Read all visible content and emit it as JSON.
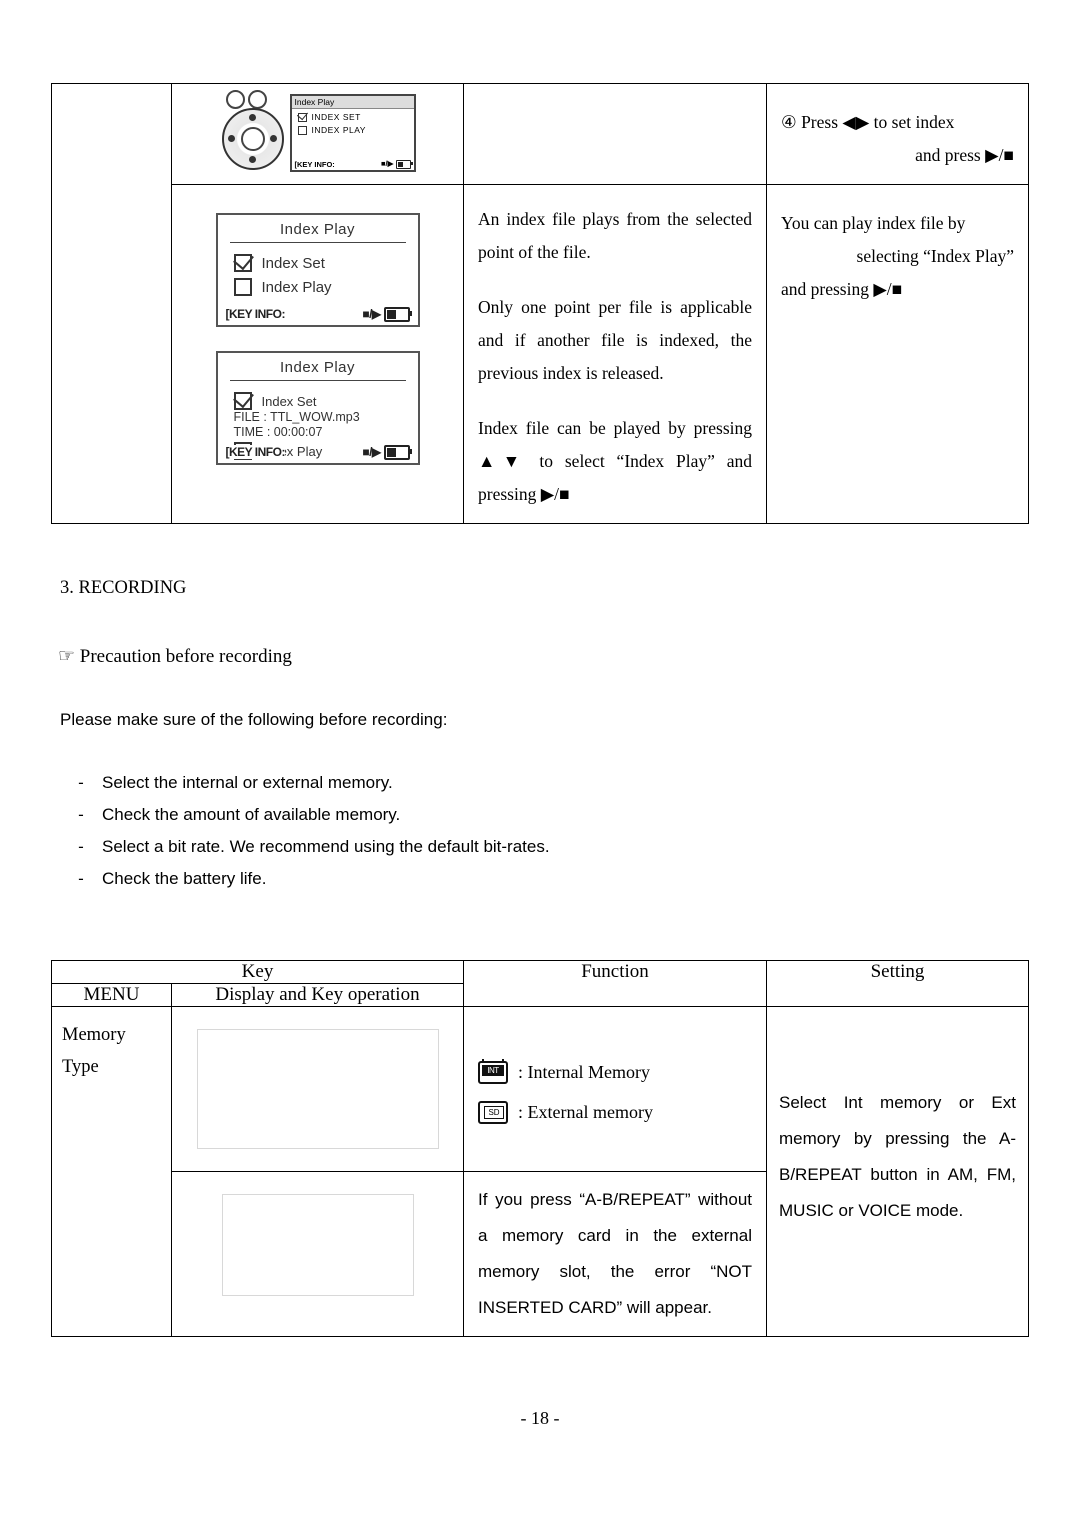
{
  "page": {
    "footer": "- 18 -"
  },
  "top_table": {
    "row1": {
      "display_device": {
        "lcd_title": "Index Play",
        "row1_label": "INDEX    SET",
        "row2_label": "INDEX    PLAY",
        "keyinfo": "[KEY INFO:",
        "bar_icon": "■/▶"
      },
      "setting": {
        "line1": "④ Press ◀▶ to set index",
        "line2": "and press ▶/■"
      }
    },
    "row2": {
      "display": {
        "lcd1": {
          "title": "Index Play",
          "item1": "Index Set",
          "item2": "Index Play",
          "keyinfo": "[KEY INFO:",
          "bar_icon": "■/▶"
        },
        "lcd2": {
          "title": "Index Play",
          "item1": "Index Set",
          "file_line": "FILE : TTL_WOW.mp3",
          "time_line": "TIME : 00:00:07",
          "item2": "Index Play",
          "keyinfo": "[KEY INFO:",
          "bar_icon": "■/▶"
        }
      },
      "function": [
        "An index file plays from the selected point of the file.",
        "Only one point per file is applicable and if another file is indexed, the previous index is released.",
        "Index file can be played by pressing ▲▼ to select “Index Play” and pressing ▶/■"
      ],
      "setting": {
        "line1": "You can play index file by",
        "line2": "selecting “Index Play”",
        "line3": "and pressing ▶/■"
      }
    }
  },
  "section": {
    "heading": "3. RECORDING",
    "subheading": "☞ Precaution before recording",
    "intro": "Please make sure of the following before recording:",
    "bullets": [
      "Select the internal or external memory.",
      "Check the amount of available memory.",
      "Select a bit rate.   We recommend using the default bit-rates.",
      "Check the battery life."
    ],
    "bullet_marker": "-"
  },
  "bottom_table": {
    "headers": {
      "key": "Key",
      "menu": "MENU",
      "display": "Display and Key operation",
      "function": "Function",
      "setting": "Setting"
    },
    "rows": [
      {
        "menu_line1": "Memory",
        "menu_line2": "Type",
        "function_icons": [
          {
            "icon": "internal-memory-icon",
            "label": ": Internal Memory"
          },
          {
            "icon": "external-memory-icon",
            "label": ": External memory"
          }
        ],
        "setting": "Select Int memory or Ext memory by pressing the A-B/REPEAT button in AM, FM, MUSIC or VOICE mode."
      },
      {
        "function": "If you press “A-B/REPEAT” without a memory card in the external memory slot, the error “NOT INSERTED CARD” will appear."
      }
    ]
  }
}
